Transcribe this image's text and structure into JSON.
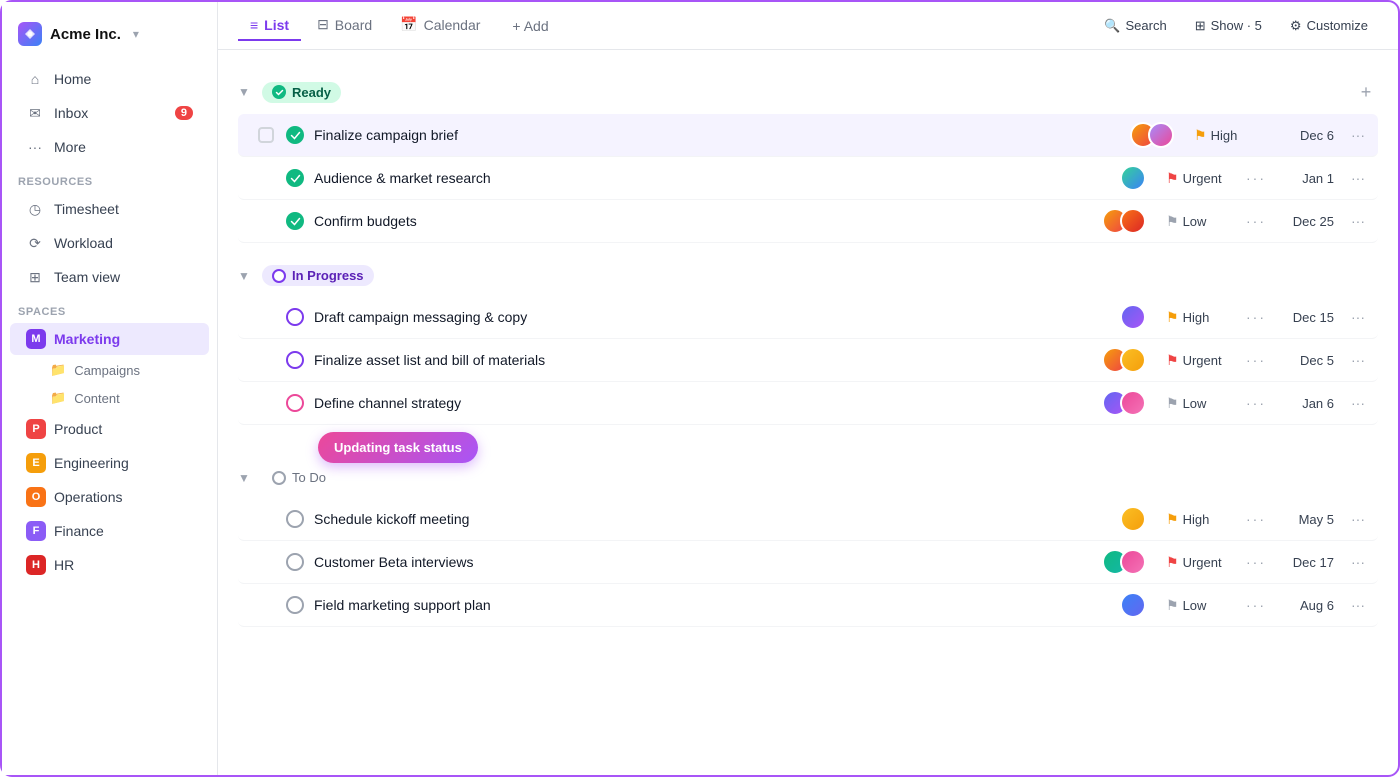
{
  "app": {
    "name": "Acme Inc.",
    "arrow": "▾"
  },
  "sidebar": {
    "nav": [
      {
        "id": "home",
        "label": "Home",
        "icon": "home"
      },
      {
        "id": "inbox",
        "label": "Inbox",
        "icon": "inbox",
        "badge": "9"
      },
      {
        "id": "more",
        "label": "More",
        "icon": "more"
      }
    ],
    "resources_label": "Resources",
    "resources": [
      {
        "id": "timesheet",
        "label": "Timesheet",
        "icon": "clock"
      },
      {
        "id": "workload",
        "label": "Workload",
        "icon": "chart"
      },
      {
        "id": "teamview",
        "label": "Team view",
        "icon": "grid"
      }
    ],
    "spaces_label": "Spaces",
    "spaces": [
      {
        "id": "marketing",
        "label": "Marketing",
        "badge_char": "M",
        "badge_class": "m",
        "active": true
      },
      {
        "id": "product",
        "label": "Product",
        "badge_char": "P",
        "badge_class": "p"
      },
      {
        "id": "engineering",
        "label": "Engineering",
        "badge_char": "E",
        "badge_class": "e"
      },
      {
        "id": "operations",
        "label": "Operations",
        "badge_char": "O",
        "badge_class": "o"
      },
      {
        "id": "finance",
        "label": "Finance",
        "badge_char": "F",
        "badge_class": "f"
      },
      {
        "id": "hr",
        "label": "HR",
        "badge_char": "H",
        "badge_class": "h"
      }
    ],
    "sub_items": [
      "Campaigns",
      "Content"
    ]
  },
  "topnav": {
    "tabs": [
      {
        "id": "list",
        "label": "List",
        "icon": "list",
        "active": true
      },
      {
        "id": "board",
        "label": "Board",
        "icon": "board"
      },
      {
        "id": "calendar",
        "label": "Calendar",
        "icon": "calendar"
      }
    ],
    "add_label": "+ Add",
    "search_label": "Search",
    "show_label": "Show · 5",
    "customize_label": "Customize"
  },
  "groups": [
    {
      "id": "ready",
      "label": "Ready",
      "type": "ready",
      "tasks": [
        {
          "id": "t1",
          "name": "Finalize campaign brief",
          "avatars": [
            "a1",
            "a2"
          ],
          "priority": "High",
          "priority_type": "high",
          "date": "Dec 6",
          "selected": true
        },
        {
          "id": "t2",
          "name": "Audience & market research",
          "avatars": [
            "a3"
          ],
          "priority": "Urgent",
          "priority_type": "urgent",
          "date": "Jan 1"
        },
        {
          "id": "t3",
          "name": "Confirm budgets",
          "avatars": [
            "a1",
            "a4"
          ],
          "priority": "Low",
          "priority_type": "low",
          "date": "Dec 25"
        }
      ]
    },
    {
      "id": "in-progress",
      "label": "In Progress",
      "type": "in-progress",
      "tasks": [
        {
          "id": "t4",
          "name": "Draft campaign messaging & copy",
          "avatars": [
            "a5"
          ],
          "priority": "High",
          "priority_type": "high",
          "date": "Dec 15"
        },
        {
          "id": "t5",
          "name": "Finalize asset list and bill of materials",
          "avatars": [
            "a1",
            "a6"
          ],
          "priority": "Urgent",
          "priority_type": "urgent",
          "date": "Dec 5"
        },
        {
          "id": "t6",
          "name": "Define channel strategy",
          "avatars": [
            "a5",
            "a8"
          ],
          "priority": "Low",
          "priority_type": "low",
          "date": "Jan 6",
          "has_tooltip": true
        }
      ]
    },
    {
      "id": "todo",
      "label": "To Do",
      "type": "todo",
      "tasks": [
        {
          "id": "t7",
          "name": "Schedule kickoff meeting",
          "avatars": [
            "a6"
          ],
          "priority": "High",
          "priority_type": "high",
          "date": "May 5"
        },
        {
          "id": "t8",
          "name": "Customer Beta interviews",
          "avatars": [
            "a7",
            "a8"
          ],
          "priority": "Urgent",
          "priority_type": "urgent",
          "date": "Dec 17"
        },
        {
          "id": "t9",
          "name": "Field marketing support plan",
          "avatars": [
            "a9"
          ],
          "priority": "Low",
          "priority_type": "low",
          "date": "Aug 6"
        }
      ]
    }
  ],
  "tooltip": {
    "text": "Updating task status"
  }
}
